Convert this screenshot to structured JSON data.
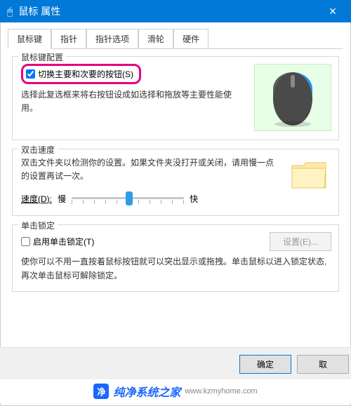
{
  "titlebar": {
    "icon": "🖱",
    "title": "鼠标 属性",
    "close": "×"
  },
  "tabs": [
    {
      "label": "鼠标键",
      "active": true
    },
    {
      "label": "指针"
    },
    {
      "label": "指针选项"
    },
    {
      "label": "滑轮"
    },
    {
      "label": "硬件"
    }
  ],
  "group_config": {
    "legend": "鼠标键配置",
    "swap_label": "切换主要和次要的按钮(S)",
    "swap_checked": true,
    "desc": "选择此复选框来将右按钮设成如选择和拖放等主要性能使用。"
  },
  "group_dblclick": {
    "legend": "双击速度",
    "desc": "双击文件夹以检测你的设置。如果文件夹没打开或关闭，请用慢一点的设置再试一次。",
    "speed_label": "速度(D):",
    "slow": "慢",
    "fast": "快"
  },
  "group_clicklock": {
    "legend": "单击锁定",
    "enable_label": "启用单击锁定(T)",
    "enable_checked": false,
    "settings_btn": "设置(E)...",
    "desc": "使你可以不用一直按着鼠标按钮就可以突出显示或拖拽。单击鼠标以进入锁定状态,再次单击鼠标可解除锁定。"
  },
  "buttons": {
    "ok": "确定",
    "cancel": "取",
    "apply": ""
  },
  "watermark": {
    "text": "纯净系统之家",
    "url": "www.kzmyhome.com"
  }
}
